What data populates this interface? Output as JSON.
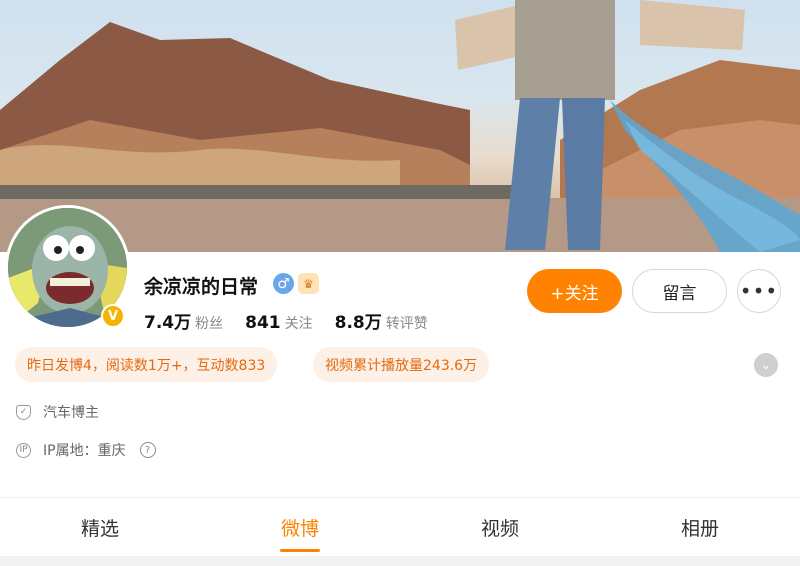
{
  "profile": {
    "name": "余凉凉的日常",
    "verified_badge": "V",
    "gender_icon": "male-icon",
    "vip_icon": "crown-icon"
  },
  "stats": [
    {
      "value": "7.4万",
      "label": "粉丝"
    },
    {
      "value": "841",
      "label": "关注"
    },
    {
      "value": "8.8万",
      "label": "转评赞"
    }
  ],
  "actions": {
    "follow_label": "+关注",
    "message_label": "留言",
    "more_label": "•••"
  },
  "highlights": {
    "yesterday": "昨日发博4，阅读数1万+，互动数833",
    "video_plays": "视频累计播放量243.6万"
  },
  "info": {
    "category": "汽车博主",
    "ip_location": "IP属地：重庆"
  },
  "tabs": [
    {
      "label": "精选"
    },
    {
      "label": "微博"
    },
    {
      "label": "视频"
    },
    {
      "label": "相册"
    }
  ],
  "colors": {
    "accent": "#ff8200",
    "pill_bg": "#fdf0e6",
    "pill_text": "#e46a10"
  }
}
